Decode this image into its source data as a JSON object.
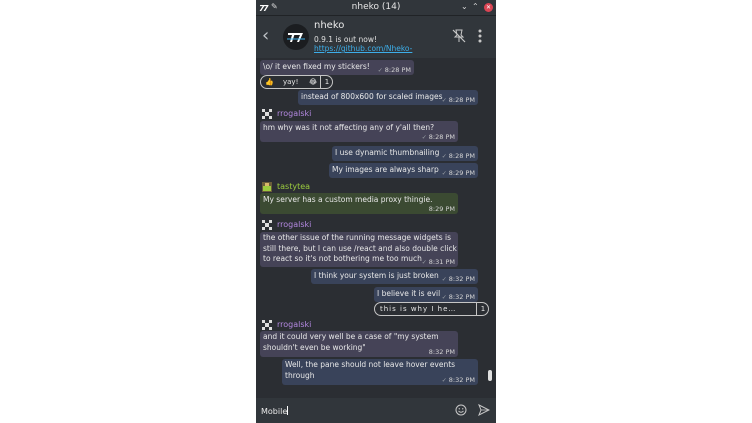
{
  "window": {
    "title": "nheko (14)"
  },
  "header": {
    "room_name": "nheko",
    "topic_text": "0.9.1 is out now! ",
    "topic_link": "https://github.com/Nheko-Reborn/"
  },
  "messages": [
    {
      "text": "\\o/ it even fixed my stickers!",
      "time": "8:28 PM",
      "mine": false
    },
    {
      "reaction_emoji": "👍",
      "reaction_text": "yay!",
      "reaction_emoji2": "😂",
      "reaction_count": "1"
    },
    {
      "text": "instead of 800x600 for scaled images",
      "time": "8:28 PM",
      "mine": true
    },
    {
      "sender": "rrogalski",
      "text": "hm why was it not affecting any of y'all then?",
      "time": "8:28 PM",
      "mine": false
    },
    {
      "text": "I use dynamic thumbnailing",
      "time": "8:28 PM",
      "mine": true
    },
    {
      "text": "My images are always sharp",
      "time": "8:29 PM",
      "mine": true
    },
    {
      "sender": "tastytea",
      "text": "My server has a custom media proxy thingie.",
      "time": "8:29 PM",
      "mine": false
    },
    {
      "sender": "rrogalski",
      "lines": [
        "the other issue of the running message widgets is",
        "still there, but I can use /react and also double click",
        "to react so it's not bothering me too much"
      ],
      "time": "8:31 PM",
      "mine": false
    },
    {
      "text": "I think your system is just broken",
      "time": "8:32 PM",
      "mine": true
    },
    {
      "text": "I believe it is evil",
      "time": "8:32 PM",
      "mine": true
    },
    {
      "reaction_text": "this is why I he…",
      "reaction_count": "1"
    },
    {
      "sender": "rrogalski",
      "lines": [
        "and it could very well be a case of \"my system",
        "shouldn't even be working\""
      ],
      "time": "8:32 PM",
      "mine": false
    },
    {
      "lines": [
        "Well, the pane should not leave hover events",
        "through"
      ],
      "time": "8:32 PM",
      "mine": true
    }
  ],
  "composer": {
    "value": "Mobile"
  },
  "colors": {
    "accent": "#3daee9",
    "sender_purple": "#b388e0",
    "sender_green": "#9ccc3f",
    "close": "#da4453"
  },
  "icons": [
    "back-icon",
    "pin-off-icon",
    "more-vertical-icon",
    "emoji-icon",
    "send-icon",
    "minimize-icon",
    "maximize-icon",
    "close-icon"
  ]
}
